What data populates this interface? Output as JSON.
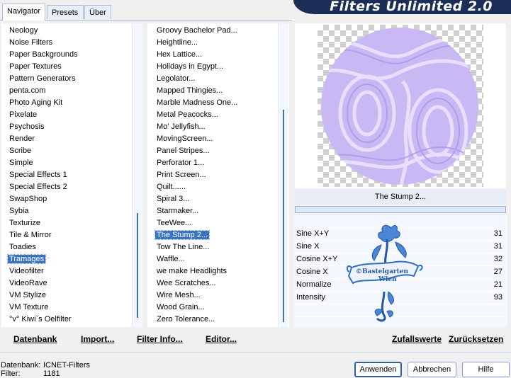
{
  "tabs": [
    {
      "label": "Navigator",
      "active": true
    },
    {
      "label": "Presets",
      "active": false
    },
    {
      "label": "Über",
      "active": false
    }
  ],
  "banner_title": "Filters Unlimited 2.0",
  "categories": [
    "Neology",
    "Noise Filters",
    "Paper Backgrounds",
    "Paper Textures",
    "Pattern Generators",
    "penta.com",
    "Photo Aging Kit",
    "Pixelate",
    "Psychosis",
    "Render",
    "Scribe",
    "Simple",
    "Special Effects 1",
    "Special Effects 2",
    "SwapShop",
    "Sybia",
    "Texturize",
    "Tile & Mirror",
    "Toadies",
    "Tramages",
    "Videofilter",
    "VideoRave",
    "VM Stylize",
    "VM Texture",
    "°v° Kiwi`s Oelfilter"
  ],
  "selected_category": "Tramages",
  "filters": [
    "Groovy Bachelor Pad...",
    "Heightline...",
    "Hex Lattice...",
    "Holidays in Egypt...",
    "Legolator...",
    "Mapped Thingies...",
    "Marble Madness One...",
    "Metal Peacocks...",
    "Mo' Jellyfish...",
    "MovingScreen...",
    "Panel Stripes...",
    "Perforator 1...",
    "Print Screen...",
    "Quilt......",
    "Spiral 3...",
    "Starmaker...",
    "TeeWee...",
    "The Stump 2...",
    "Tow The Line...",
    "Waffle...",
    "we make Headlights",
    "Wee Scratches...",
    "Wire Mesh...",
    "Wood Grain...",
    "Zero Tolerance..."
  ],
  "selected_filter": "The Stump 2...",
  "current_filter_name": "The Stump 2...",
  "parameters": [
    {
      "label": "Sine X+Y",
      "value": "31"
    },
    {
      "label": "Sine X",
      "value": "31"
    },
    {
      "label": "Cosine X+Y",
      "value": "32"
    },
    {
      "label": "Cosine X",
      "value": "27"
    },
    {
      "label": "Normalize",
      "value": "21"
    },
    {
      "label": "Intensity",
      "value": "93"
    }
  ],
  "watermark": {
    "line1": "©Bastelgarten",
    "line2": "Wien"
  },
  "bottom_buttons": {
    "database": "Datenbank",
    "import": "Import...",
    "filter_info": "Filter Info...",
    "editor": "Editor...",
    "randomize": "Zufallswerte",
    "reset": "Zurücksetzen"
  },
  "status": {
    "database_label": "Datenbank:",
    "database_value": "ICNET-Filters",
    "filter_label": "Filter:",
    "filter_value": "1181"
  },
  "dialog_buttons": {
    "apply": "Anwenden",
    "cancel": "Abbrechen",
    "help": "Hilfe"
  },
  "colors": {
    "accent": "#3b73c4",
    "banner": "#1b2e57",
    "preview_tint": "#c8b8f4",
    "watermark": "#2f6fc4"
  }
}
